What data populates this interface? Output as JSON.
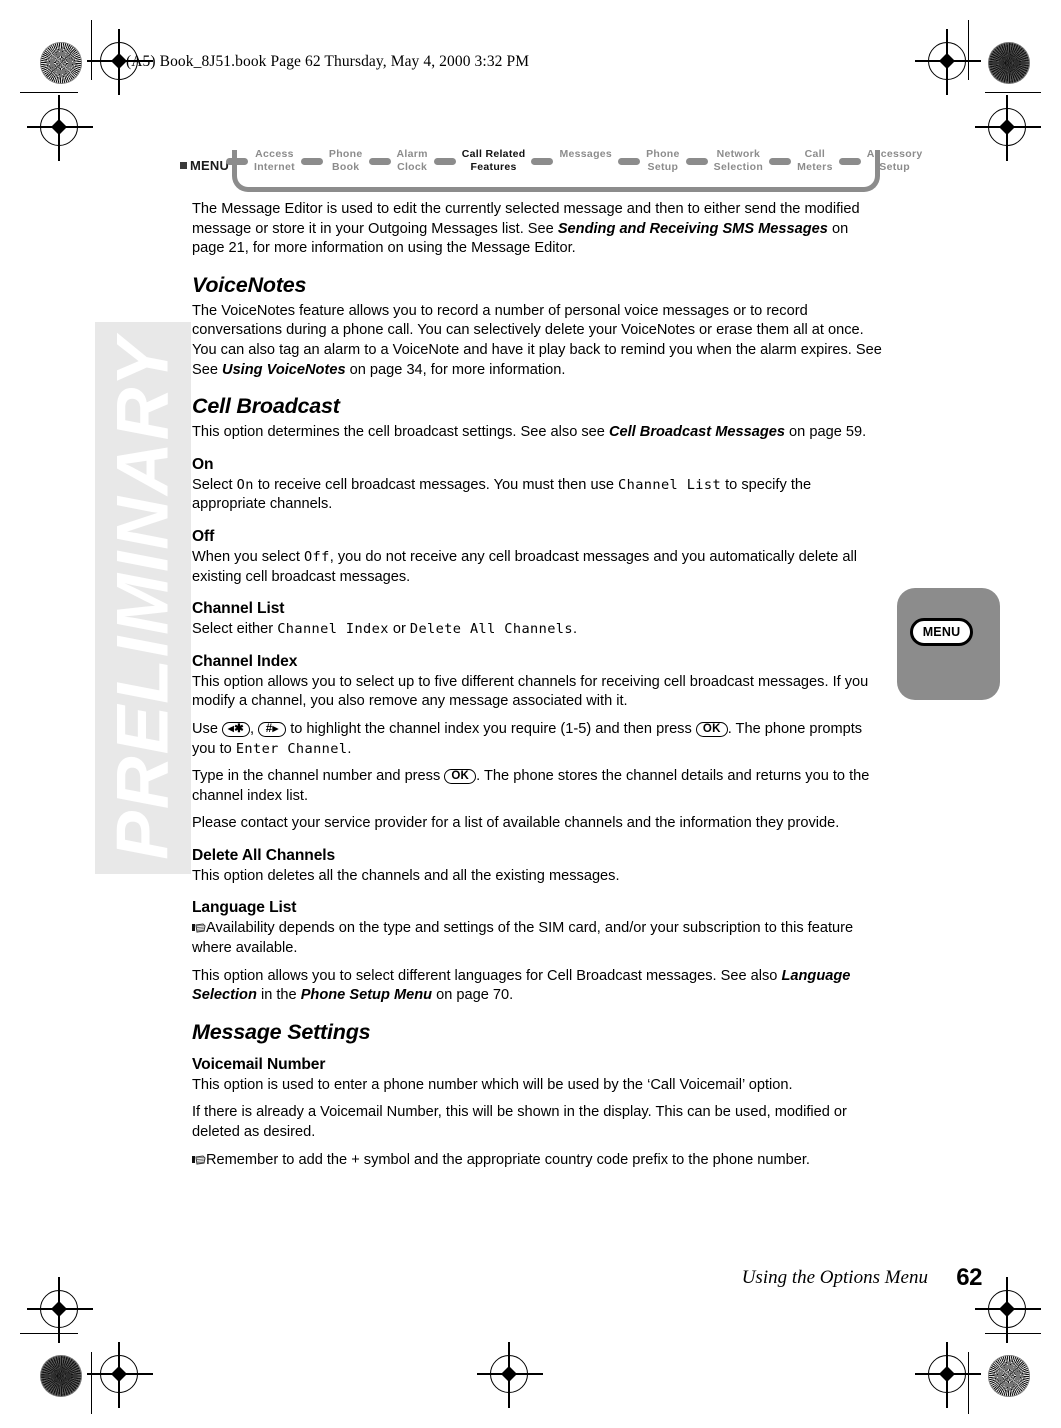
{
  "header": {
    "run_line": "(A5) Book_8J51.book  Page 62  Thursday, May 4, 2000  3:32 PM"
  },
  "watermark": {
    "text": "PRELIMINARY"
  },
  "navbar": {
    "menu_label": "MENU",
    "items": [
      {
        "label": "Access\nInternet",
        "active": false
      },
      {
        "label": "Phone\nBook",
        "active": false
      },
      {
        "label": "Alarm\nClock",
        "active": false
      },
      {
        "label": "Call Related\nFeatures",
        "active": true
      },
      {
        "label": "Messages",
        "active": false
      },
      {
        "label": "Phone\nSetup",
        "active": false
      },
      {
        "label": "Network\nSelection",
        "active": false
      },
      {
        "label": "Call\nMeters",
        "active": false
      },
      {
        "label": "Accessory\nSetup",
        "active": false
      }
    ]
  },
  "side_tab": {
    "button_label": "MENU"
  },
  "content": {
    "intro_p1_a": "The Message Editor is used to edit the currently selected message and then to either send the modified message or store it in your Outgoing Messages list. See ",
    "intro_p1_ref": "Sending and Receiving SMS Messages",
    "intro_p1_b": " on page 21, for more information on using the Message Editor.",
    "voicenotes_heading": "VoiceNotes",
    "voicenotes_p_a": "The VoiceNotes feature allows you to record a number of personal voice messages or to record conversations during a phone call. You can selectively delete your VoiceNotes or erase them all at once. You can also tag an alarm to a VoiceNote and have it play back to remind you when the alarm expires. See See ",
    "voicenotes_p_ref": "Using VoiceNotes",
    "voicenotes_p_b": " on page 34, for more information.",
    "cellbroadcast_heading": "Cell Broadcast",
    "cellbroadcast_p_a": "This option determines the cell broadcast settings. See also see ",
    "cellbroadcast_p_ref": "Cell Broadcast Messages",
    "cellbroadcast_p_b": " on page 59.",
    "on_heading": "On",
    "on_p_a": "Select ",
    "on_p_lcd1": "On",
    "on_p_b": " to receive cell broadcast messages. You must then use ",
    "on_p_lcd2": "Channel List",
    "on_p_c": " to specify the appropriate channels.",
    "off_heading": "Off",
    "off_p_a": "When you select ",
    "off_p_lcd1": "Off",
    "off_p_b": ", you do not receive any cell broadcast messages and you automatically delete all existing cell broadcast messages.",
    "channellist_heading": "Channel List",
    "channellist_p_a": "Select either ",
    "channellist_p_lcd1": "Channel Index",
    "channellist_p_b": " or ",
    "channellist_p_lcd2": "Delete All Channels",
    "channellist_p_c": ".",
    "channelindex_heading": "Channel Index",
    "channelindex_p1": "This option allows you to select up to five different channels for receiving cell broadcast messages. If you modify a channel, you also remove any message associated with it.",
    "channelindex_p2_a": "Use ",
    "channelindex_p2_b": ", ",
    "channelindex_p2_c": " to highlight the channel index you require (1-5) and then press ",
    "channelindex_p2_d": ". The phone prompts you to ",
    "channelindex_p2_lcd": "Enter Channel",
    "channelindex_p2_e": ".",
    "channelindex_p3_a": "Type in the channel number and press ",
    "channelindex_p3_b": ". The phone stores the channel details and returns you to the channel index list.",
    "channelindex_p4": "Please contact your service provider for a list of available channels and the information they provide.",
    "deleteall_heading": "Delete All Channels",
    "deleteall_p": "This option deletes all the channels and all the existing messages.",
    "languagelist_heading": "Language List",
    "languagelist_note": "Availability depends on the type and settings of the SIM card, and/or your subscription to this feature where available.",
    "languagelist_p_a": "This option allows you to select different languages for Cell Broadcast messages. See also ",
    "languagelist_p_ref1": "Language Selection",
    "languagelist_p_b": " in the ",
    "languagelist_p_ref2": "Phone Setup Menu",
    "languagelist_p_c": " on page 70.",
    "messagesettings_heading": "Message Settings",
    "voicemail_heading": "Voicemail Number",
    "voicemail_p1": "This option is used to enter a phone number which will be used by the ‘Call Voicemail’ option.",
    "voicemail_p2": "If there is already a Voicemail Number, this will be shown in the display. This can be used, modified or deleted as desired.",
    "voicemail_note": "Remember to add the + symbol and the appropriate country code prefix to the phone number."
  },
  "keys": {
    "star_key": "◂✱",
    "hash_key": "#▸",
    "ok_key": "OK"
  },
  "footer": {
    "title": "Using the Options Menu",
    "page_number": "62"
  }
}
